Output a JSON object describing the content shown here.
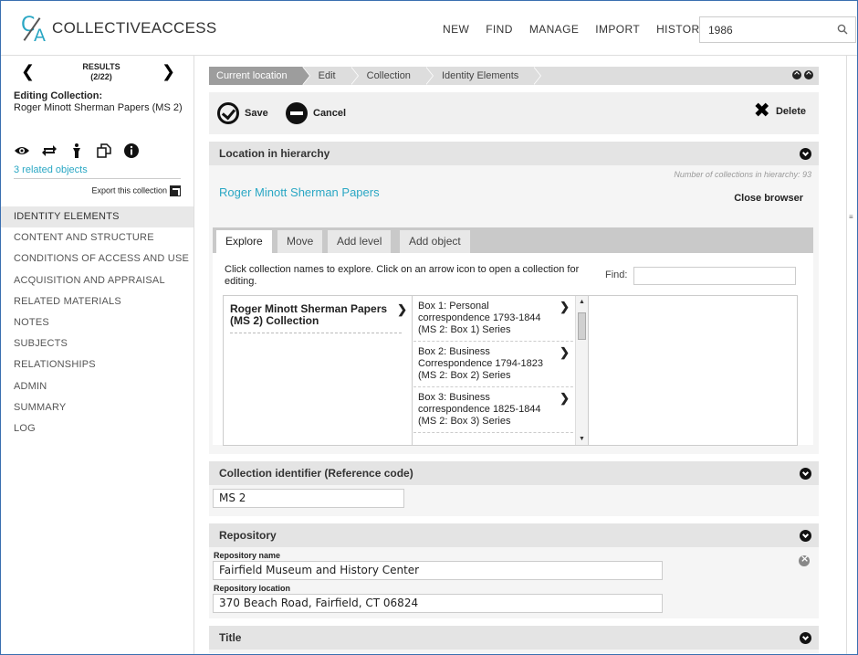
{
  "app": {
    "logo_text": "COLLECTIVEACCESS",
    "logo_c": "C",
    "logo_a": "A"
  },
  "topnav": {
    "items": [
      "NEW",
      "FIND",
      "MANAGE",
      "IMPORT",
      "HISTORY"
    ]
  },
  "search": {
    "value": "1986"
  },
  "sidebar": {
    "results_label": "RESULTS",
    "results_count": "(2/22)",
    "editing_heading": "Editing Collection:",
    "editing_name": "Roger Minott Sherman Papers (MS 2)",
    "related_link": "3 related objects",
    "export_label": "Export this collection",
    "icons": [
      "eye-icon",
      "swap-icon",
      "person-icon",
      "duplicate-icon",
      "info-icon"
    ],
    "nav": [
      "IDENTITY ELEMENTS",
      "CONTENT AND STRUCTURE",
      "CONDITIONS OF ACCESS AND USE",
      "ACQUISITION AND APPRAISAL",
      "RELATED MATERIALS",
      "NOTES",
      "SUBJECTS",
      "RELATIONSHIPS",
      "ADMIN",
      "SUMMARY",
      "LOG"
    ],
    "active_index": 0
  },
  "breadcrumb": [
    "Current location",
    "Edit",
    "Collection",
    "Identity Elements"
  ],
  "toolbar": {
    "save_label": "Save",
    "cancel_label": "Cancel",
    "delete_label": "Delete"
  },
  "hierarchy": {
    "title": "Location in hierarchy",
    "count_text": "Number of collections in hierarchy: 93",
    "root_link": "Roger Minott Sherman Papers",
    "close_label": "Close browser",
    "tabs": [
      "Explore",
      "Move",
      "Add level",
      "Add object"
    ],
    "active_tab": 0,
    "instructions": "Click collection names to explore. Click on an arrow icon to open a collection for editing.",
    "find_label": "Find:",
    "find_value": "",
    "column1": "Roger Minott Sherman Papers (MS 2) Collection",
    "column2": [
      "Box 1: Personal correspondence 1793-1844 (MS 2: Box 1) Series",
      "Box 2: Business Correspondence 1794-1823 (MS 2: Box 2) Series",
      "Box 3: Business correspondence 1825-1844 (MS 2: Box 3) Series"
    ]
  },
  "identifier": {
    "title": "Collection identifier (Reference code)",
    "value": "MS 2"
  },
  "repository": {
    "title": "Repository",
    "name_label": "Repository name",
    "name_value": "Fairfield Museum and History Center",
    "location_label": "Repository location",
    "location_value": "370 Beach Road, Fairfield, CT 06824"
  },
  "title_panel": {
    "title": "Title"
  },
  "colors": {
    "accent": "#2aa7c4",
    "panel_header": "#e4e4e4",
    "active_crumb": "#9d9d9d"
  }
}
